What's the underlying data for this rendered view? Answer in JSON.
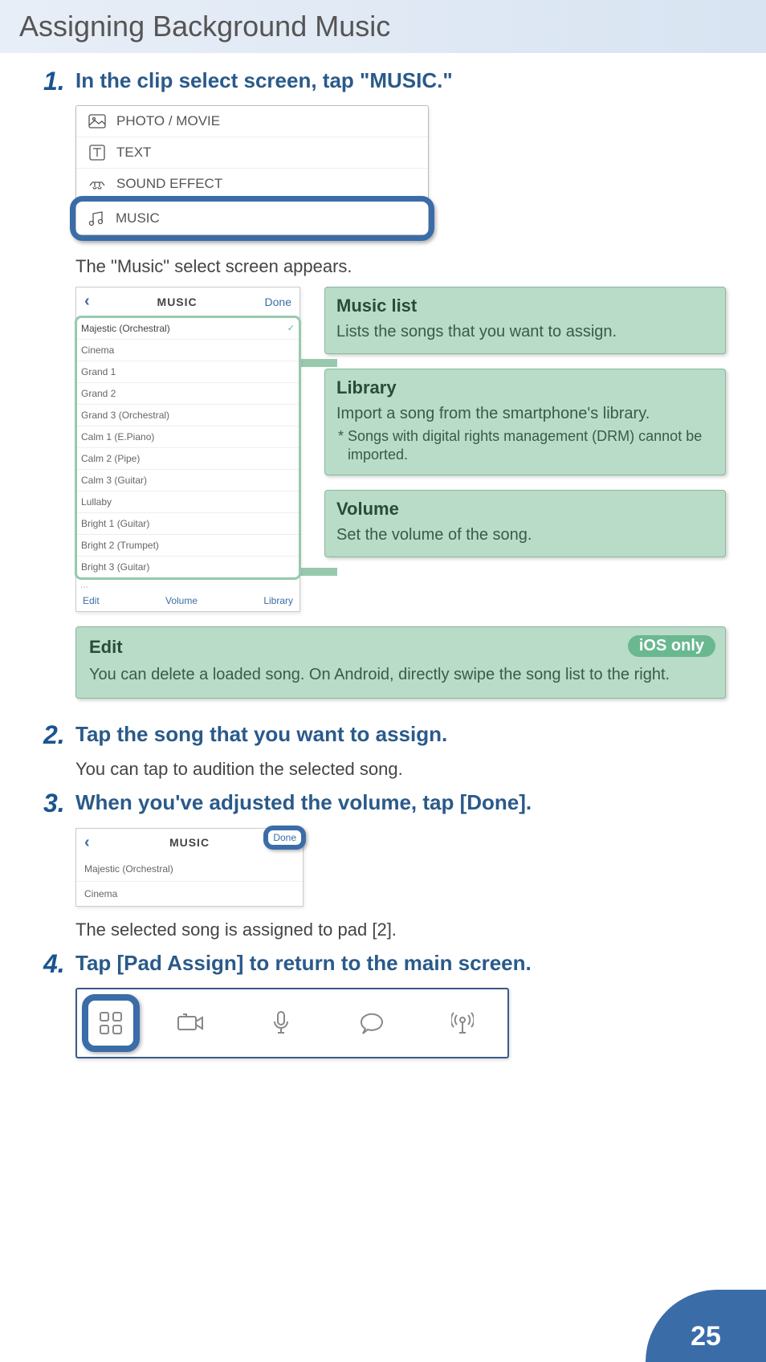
{
  "page_title": "Assigning Background Music",
  "page_number": "25",
  "steps": [
    {
      "num": "1.",
      "title": "In the clip select screen, tap \"MUSIC.\""
    },
    {
      "num": "2.",
      "title": "Tap the song that you want to assign."
    },
    {
      "num": "3.",
      "title": "When you've adjusted the volume, tap [Done]."
    },
    {
      "num": "4.",
      "title": "Tap [Pad Assign] to return to the main screen."
    }
  ],
  "step1_after": "The \"Music\" select screen appears.",
  "clip_select": {
    "items": [
      "PHOTO / MOVIE",
      "TEXT",
      "SOUND EFFECT",
      "MUSIC"
    ]
  },
  "music_screen": {
    "back": "‹",
    "title": "MUSIC",
    "done": "Done",
    "songs": [
      "Majestic (Orchestral)",
      "Cinema",
      "Grand 1",
      "Grand 2",
      "Grand 3 (Orchestral)",
      "Calm 1 (E.Piano)",
      "Calm 2 (Pipe)",
      "Calm 3 (Guitar)",
      "Lullaby",
      "Bright 1 (Guitar)",
      "Bright 2 (Trumpet)",
      "Bright 3 (Guitar)"
    ],
    "footer": {
      "edit": "Edit",
      "volume": "Volume",
      "library": "Library"
    }
  },
  "callouts": {
    "music_list": {
      "title": "Music list",
      "body": "Lists the songs that you want to assign."
    },
    "library": {
      "title": "Library",
      "body": "Import a song from the smartphone's library.",
      "note": "* Songs with digital rights management (DRM) cannot be imported."
    },
    "volume": {
      "title": "Volume",
      "body": "Set the volume of the song."
    },
    "edit": {
      "title": "Edit",
      "badge": "iOS only",
      "body": "You can delete a loaded song. On Android, directly swipe the song list to the right."
    }
  },
  "step2_body": "You can tap to audition the selected song.",
  "done_screen": {
    "back": "‹",
    "title": "MUSIC",
    "done": "Done",
    "songs": [
      "Majestic (Orchestral)",
      "Cinema"
    ]
  },
  "step3_after": "The selected song is assigned to pad [2]."
}
